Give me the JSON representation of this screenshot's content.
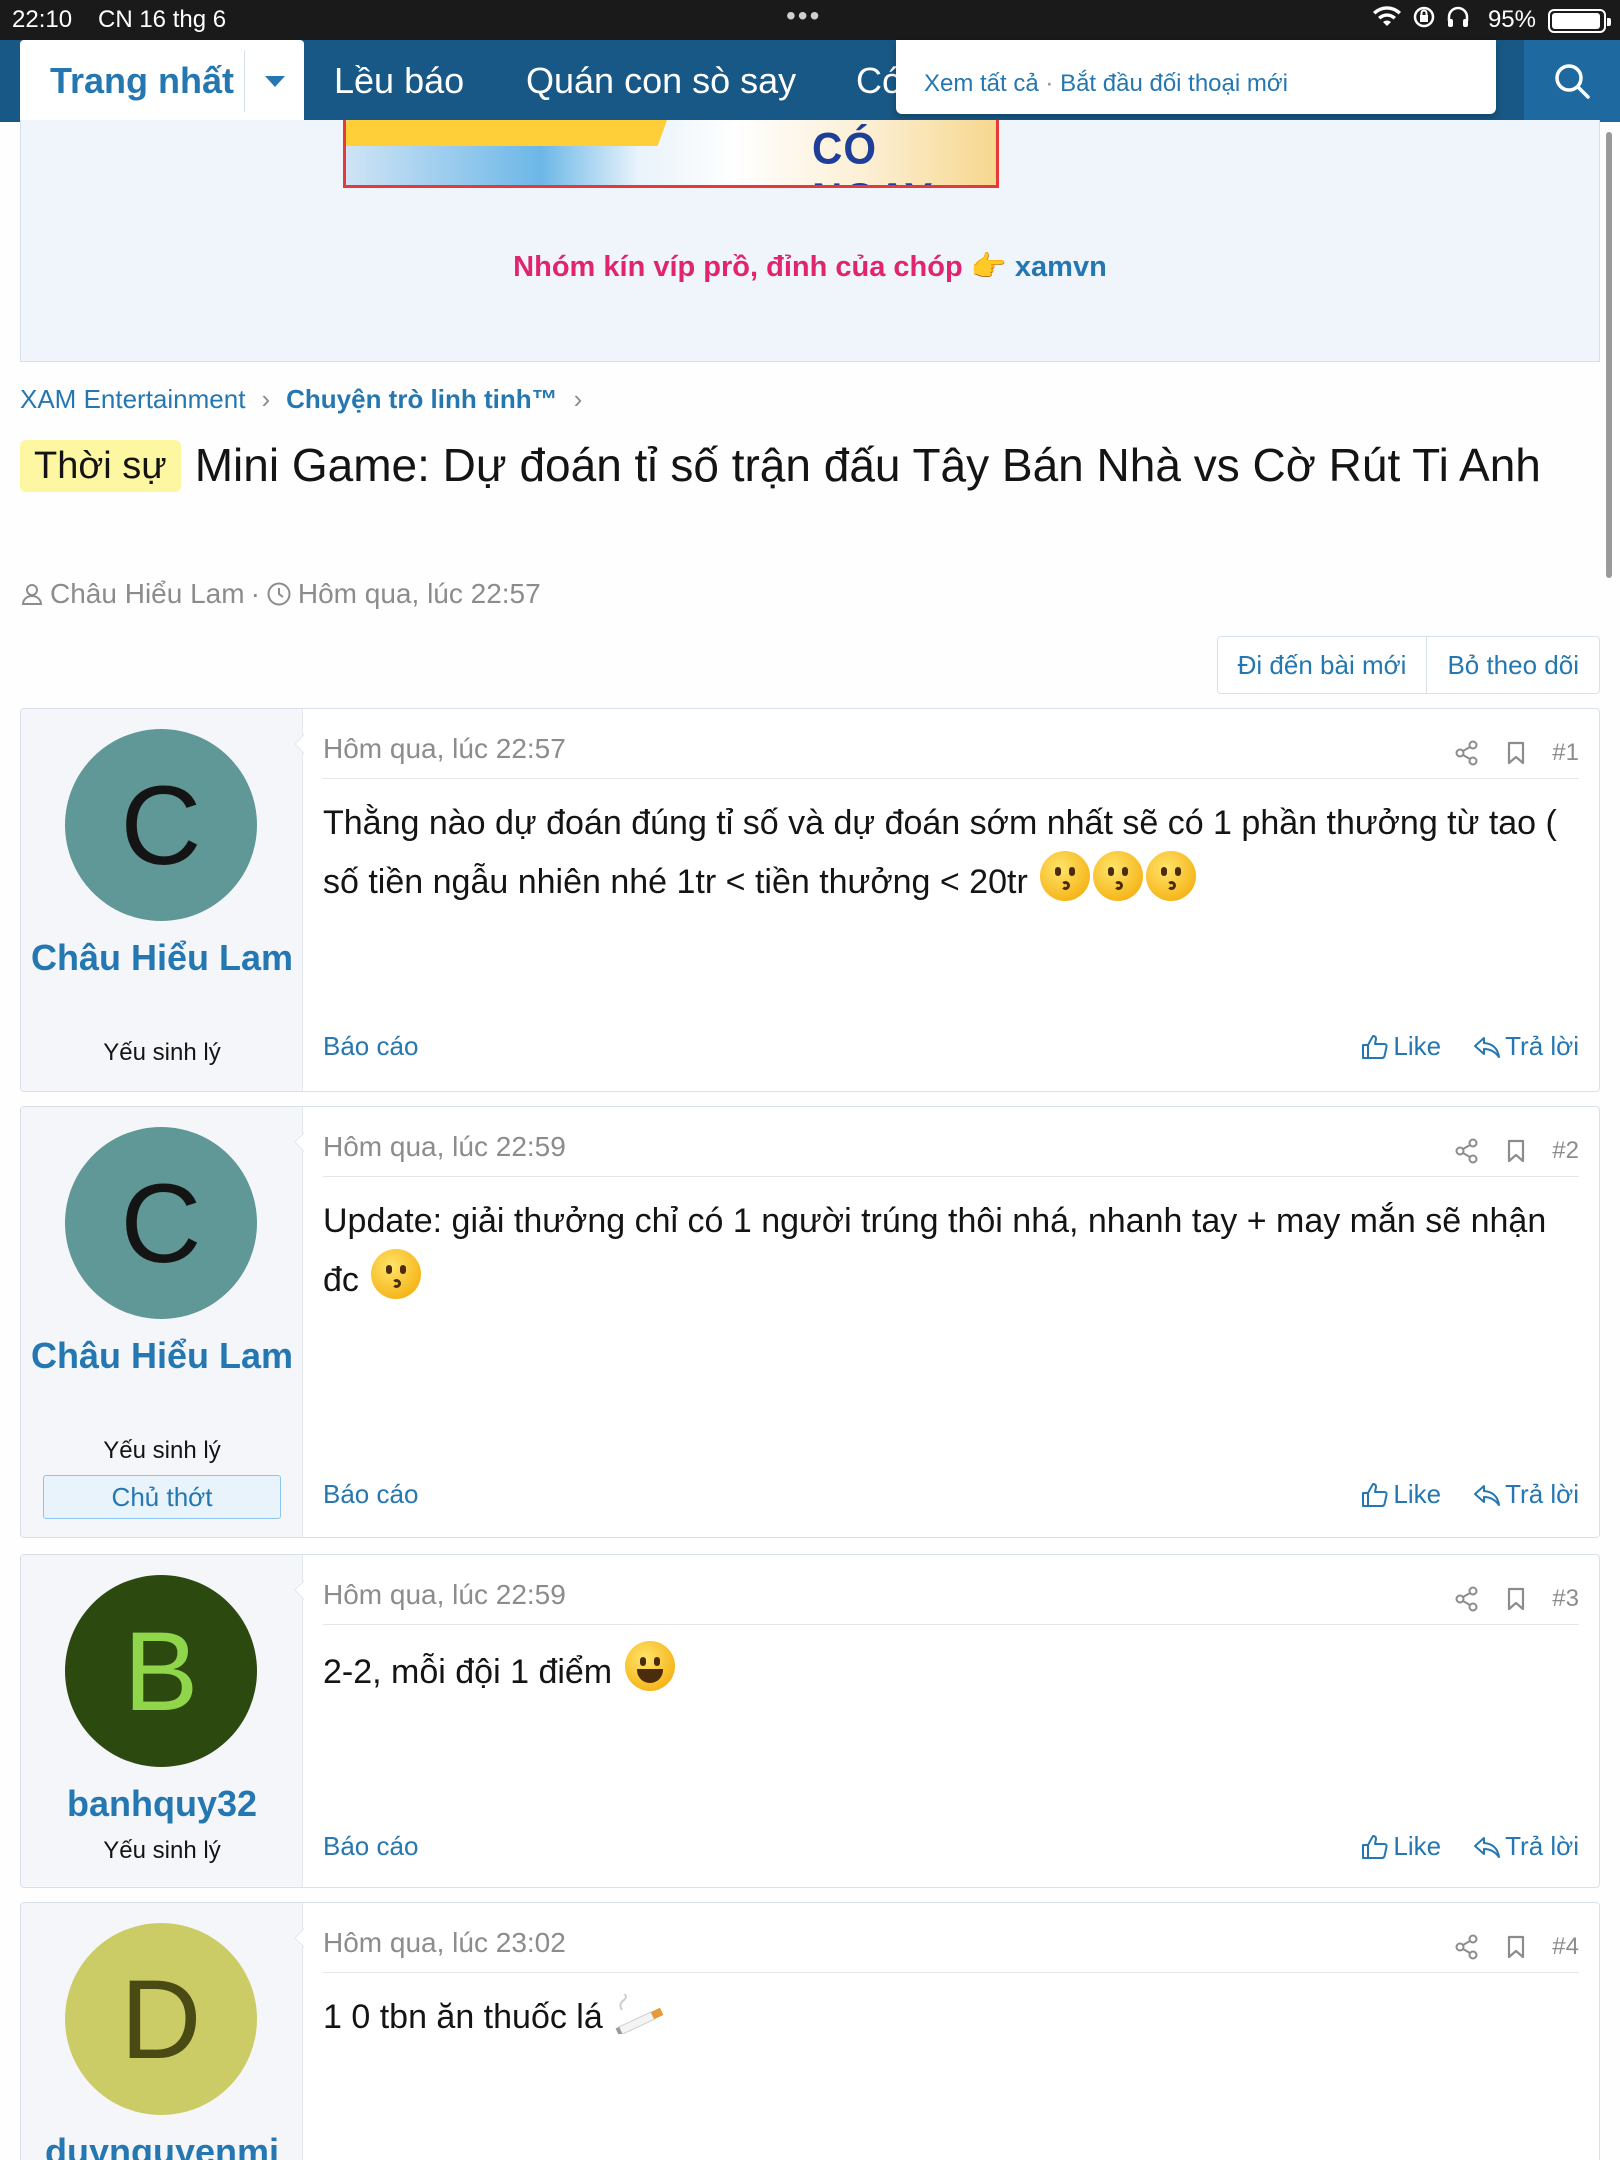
{
  "status_bar": {
    "time": "22:10",
    "date": "CN 16 thg 6",
    "dots": "•••",
    "battery_pct": "95%"
  },
  "nav": {
    "home": "Trang nhất",
    "items": [
      "Lều báo",
      "Quán con sò say",
      "Có"
    ]
  },
  "popup": {
    "view_all": "Xem tất cả",
    "separator": "·",
    "new_conversation": "Bắt đầu đối thoại mới"
  },
  "ad": {
    "banner_text": "CÓ NGAY",
    "promo_text": "Nhóm kín víp prồ, đỉnh của chóp 👉",
    "promo_link": "xamvn"
  },
  "breadcrumb": [
    "XAM Entertainment",
    "Chuyện trò linh tinh™"
  ],
  "thread": {
    "prefix": "Thời sự",
    "title": "Mini Game: Dự đoán tỉ số trận đấu Tây Bán Nhà vs Cờ Rút Ti Anh",
    "author": "Châu Hiểu Lam",
    "meta_sep": "·",
    "date": "Hôm qua, lúc 22:57"
  },
  "buttons": {
    "go_new": "Đi đến bài mới",
    "unwatch": "Bỏ theo dõi"
  },
  "post_actions": {
    "report": "Báo cáo",
    "like": "Like",
    "reply": "Trả lời"
  },
  "posts": [
    {
      "initial": "C",
      "avatar_bg": "#5f9896",
      "avatar_fg": "#141414",
      "username": "Châu Hiểu Lam",
      "user_title": "Yếu sinh lý",
      "banner": "",
      "date": "Hôm qua, lúc 22:57",
      "num": "#1",
      "text": "Thằng nào dự đoán đúng tỉ số và dự đoán sớm nhất sẽ có 1 phần thưởng từ tao ( số tiền ngẫu nhiên nhé 1tr < tiền thưởng < 20tr",
      "emoji": [
        "kissing",
        "kissing",
        "kissing"
      ]
    },
    {
      "initial": "C",
      "avatar_bg": "#5f9896",
      "avatar_fg": "#141414",
      "username": "Châu Hiểu Lam",
      "user_title": "Yếu sinh lý",
      "banner": "Chủ thớt",
      "date": "Hôm qua, lúc 22:59",
      "num": "#2",
      "text": "Update: giải thưởng chỉ có 1 người trúng thôi nhá, nhanh tay + may mắn sẽ nhận đc",
      "emoji": [
        "kissing"
      ]
    },
    {
      "initial": "B",
      "avatar_bg": "#2c4a10",
      "avatar_fg": "#8fd64a",
      "username": "banhquy32",
      "user_title": "Yếu sinh lý",
      "banner": "",
      "date": "Hôm qua, lúc 22:59",
      "num": "#3",
      "text": "2-2, mỗi đội 1 điểm",
      "emoji": [
        "grinning"
      ]
    },
    {
      "initial": "D",
      "avatar_bg": "#cccc66",
      "avatar_fg": "#4a4a14",
      "username": "duynguyenmi",
      "user_title": "",
      "banner": "",
      "date": "Hôm qua, lúc 23:02",
      "num": "#4",
      "text": "1 0 tbn ăn thuốc lá",
      "emoji": [
        "cigarette"
      ]
    }
  ],
  "colors": {
    "nav_bg": "#185886",
    "link": "#2577b1",
    "prefix_bg": "#fdf7a1",
    "promo": "#e0246f"
  }
}
